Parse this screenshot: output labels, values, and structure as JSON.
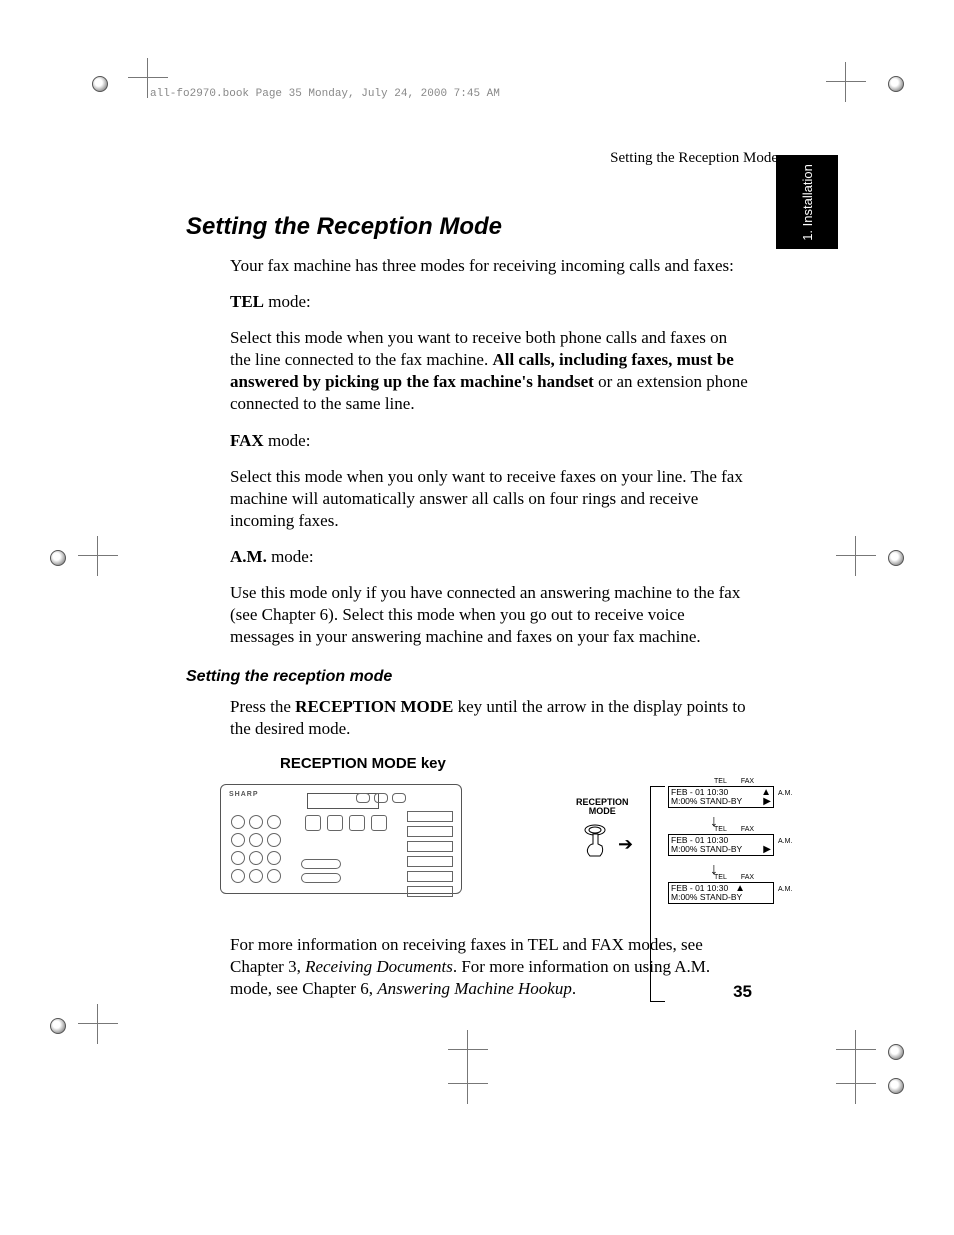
{
  "meta_header": "all-fo2970.book  Page 35  Monday, July 24, 2000  7:45 AM",
  "running_head": "Setting the Reception Mode",
  "chapter_tab": "1. Installation",
  "title": "Setting the Reception Mode",
  "intro": "Your fax machine has three modes for receiving incoming calls and faxes:",
  "tel": {
    "head_bold": "TEL",
    "head_rest": " mode:",
    "line1": "Select this mode when you want to receive both phone calls and faxes on the line connected to the fax machine. ",
    "bold": "All calls, including faxes, must be answered by picking up the fax machine's handset",
    "line2": " or an extension phone connected to the same line."
  },
  "fax": {
    "head_bold": "FAX",
    "head_rest": " mode:",
    "body": "Select this mode when you only want to receive faxes on your line. The fax machine will automatically answer all calls on four rings and receive incoming faxes."
  },
  "am": {
    "head_bold": "A.M.",
    "head_rest": " mode:",
    "body": "Use this mode only if you have connected an answering machine to the fax (see Chapter 6). Select this mode when you go out to receive voice messages in your answering machine and faxes on your fax machine."
  },
  "subhead": "Setting the reception mode",
  "instruction": {
    "pre": "Press the ",
    "key": "RECEPTION MODE",
    "post": " key until the arrow in the display points to the desired mode."
  },
  "key_label": "RECEPTION MODE key",
  "diagram": {
    "brand": "SHARP",
    "rm_label_1": "RECEPTION",
    "rm_label_2": "MODE",
    "labels": {
      "tel": "TEL",
      "fax": "FAX",
      "am": "A.M."
    },
    "display_line1": "FEB - 01  10:30",
    "display_line2": "M:00% STAND-BY",
    "pointer_positions": [
      "fax",
      "am",
      "tel"
    ]
  },
  "footer": {
    "t1": "For more information on receiving faxes in TEL and FAX modes, see Chapter 3, ",
    "i1": "Receiving Documents",
    "t2": ". For more information on using A.M. mode, see Chapter 6, ",
    "i2": "Answering Machine Hookup",
    "t3": "."
  },
  "page_number": "35"
}
